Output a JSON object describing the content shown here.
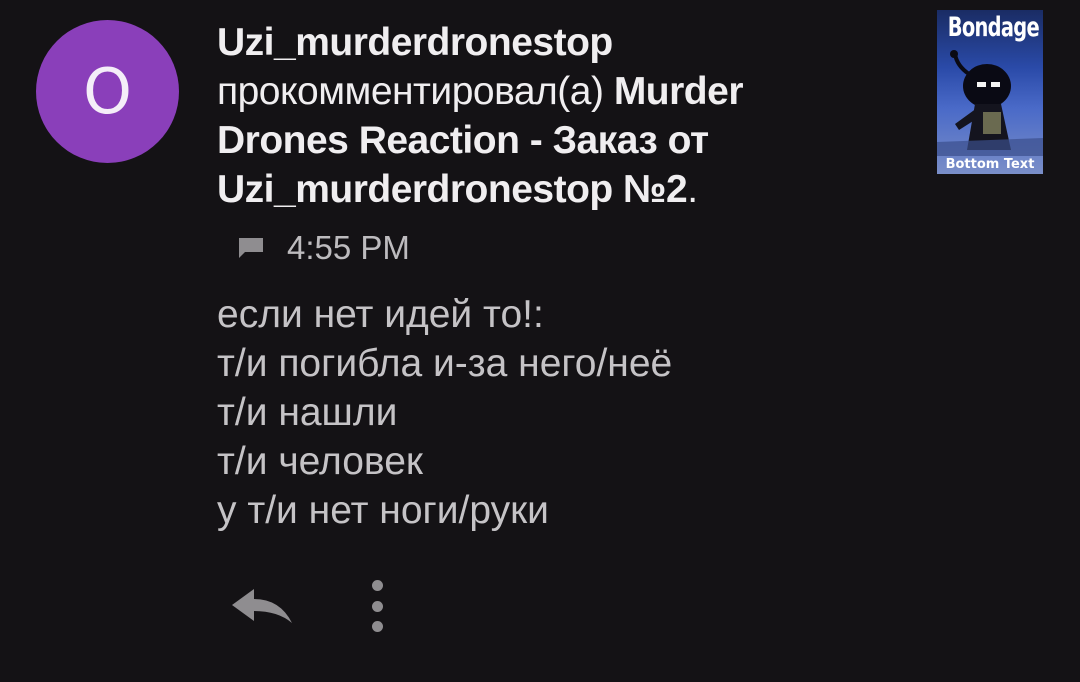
{
  "avatar": {
    "letter": "O",
    "color": "#8a3fba"
  },
  "notification": {
    "username": "Uzi_murderdronestop",
    "action": "прокомментировал(а)",
    "post_title": "Murder Drones Reaction - Заказ от Uzi_murderdronestop №2",
    "period": "."
  },
  "thumbnail": {
    "top_text": "Bondage",
    "bottom_text": "Bottom Text"
  },
  "meta": {
    "icon": "comment-icon",
    "time": "4:55 PM"
  },
  "comment": {
    "lines": [
      "если нет идей то!:",
      "т/и погибла и-за него/неё",
      "т/и нашли",
      "т/и человек",
      "у т/и нет ноги/руки"
    ]
  },
  "actions": {
    "reply_icon": "reply-icon",
    "more_icon": "more-vertical-icon"
  }
}
